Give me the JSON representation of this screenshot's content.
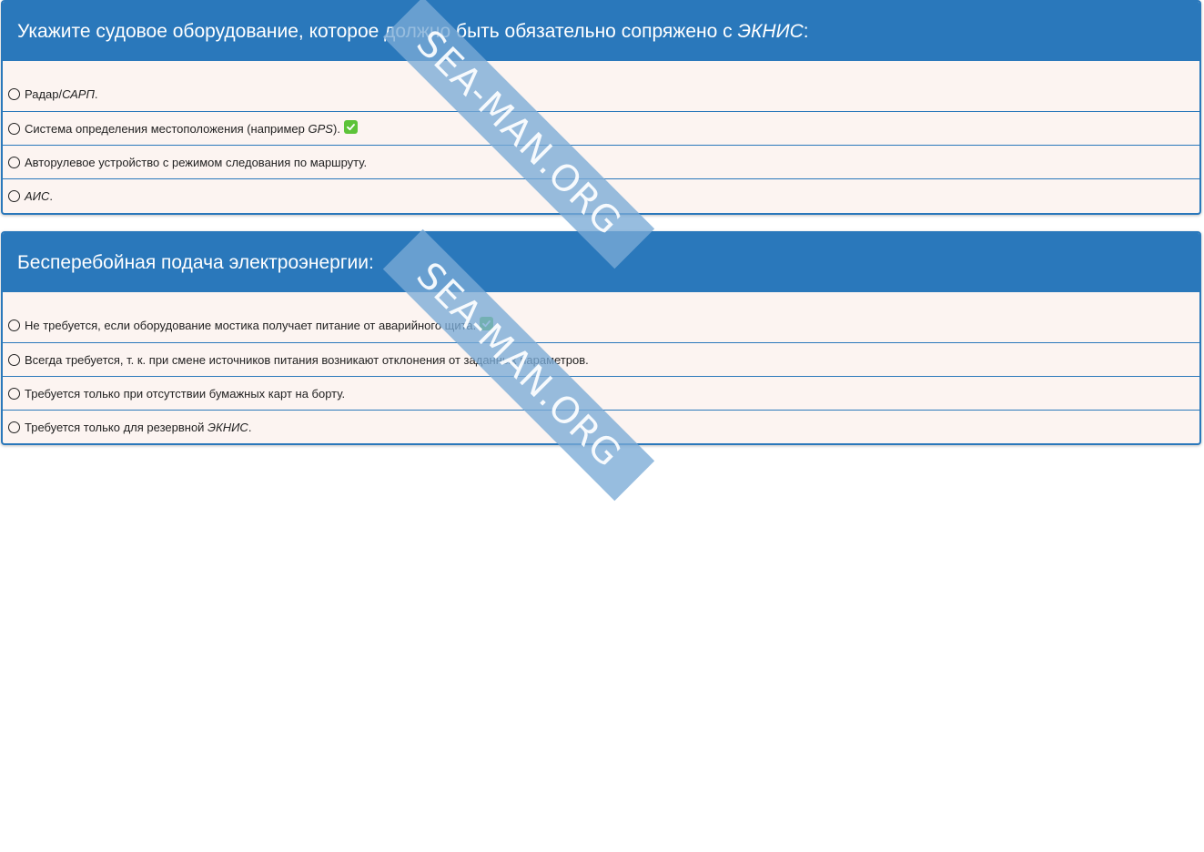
{
  "questions": [
    {
      "title_main": "Укажите судовое оборудование, которое должно быть обязательно сопряжено с ",
      "title_em": "ЭКНИС",
      "title_end": ":",
      "options": [
        {
          "pre": "Радар/",
          "em": "САРП",
          "post": ".",
          "correct": false
        },
        {
          "pre": "Система определения местоположения (например ",
          "em": "GPS",
          "post": ").",
          "correct": true
        },
        {
          "pre": "Авторулевое устройство с режимом следования по маршруту.",
          "em": "",
          "post": "",
          "correct": false
        },
        {
          "pre": "",
          "em": "АИС",
          "post": ".",
          "correct": false
        }
      ]
    },
    {
      "title_main": "Бесперебойная подача электроэнергии:",
      "title_em": "",
      "title_end": "",
      "options": [
        {
          "pre": "Не требуется, если оборудование мостика получает питание от аварийного щита.",
          "em": "",
          "post": "",
          "correct": true
        },
        {
          "pre": "Всегда требуется, т. к. при смене источников питания возникают отклонения от заданных параметров.",
          "em": "",
          "post": "",
          "correct": false
        },
        {
          "pre": "Требуется только при отсутствии бумажных карт на борту.",
          "em": "",
          "post": "",
          "correct": false
        },
        {
          "pre": "Требуется только для резервной ",
          "em": "ЭКНИС",
          "post": ".",
          "correct": false
        }
      ]
    }
  ],
  "watermark": "SEA-MAN.ORG",
  "colors": {
    "header": "#2a78bb",
    "option_bg": "#fcf4f1",
    "correct_mark": "#5dc339"
  }
}
